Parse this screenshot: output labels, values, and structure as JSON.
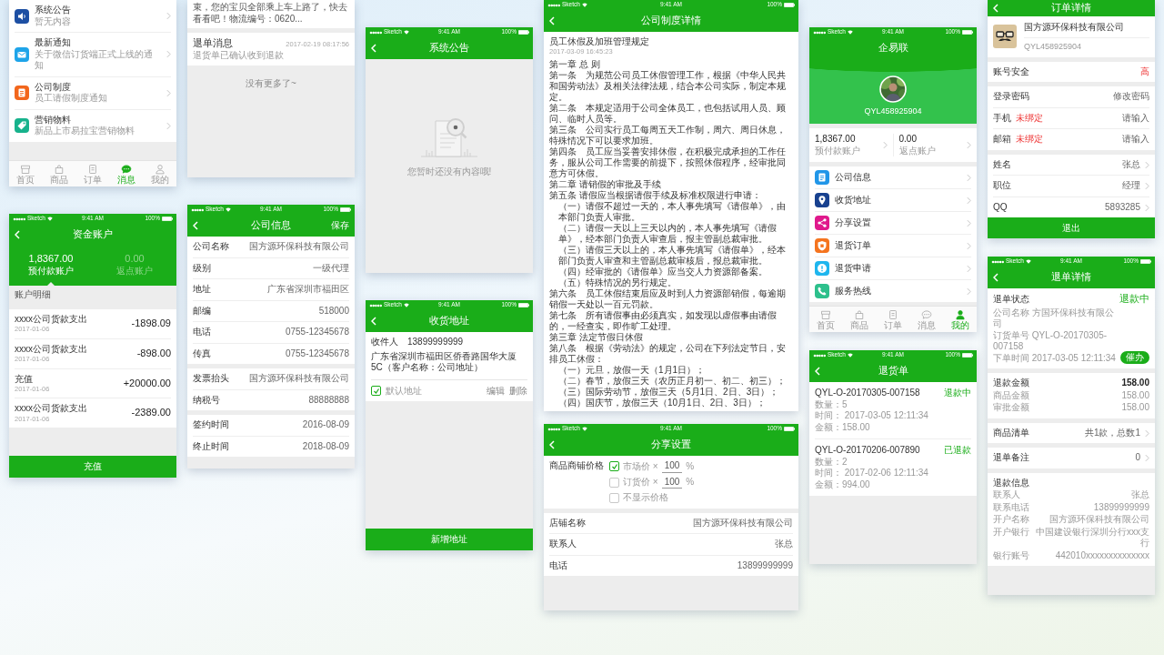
{
  "columns": [
    [
      {
        "blocks": [
          {
            "kind": "messages",
            "items": [
              {
                "title": "系统公告",
                "subtitle": "暂无内容",
                "color": "#1d4fa3"
              },
              {
                "title": "最新通知",
                "subtitle": "关于微信订货端正式上线的通知",
                "color": "#1ea4e9"
              },
              {
                "title": "公司制度",
                "subtitle": "员工请假制度通知",
                "color": "#f2661c"
              },
              {
                "title": "营销物料",
                "subtitle": "新品上市易拉宝营销物料",
                "color": "#17b28c"
              }
            ]
          }
        ],
        "tabs": [
          {
            "label": "首页",
            "selected": false
          },
          {
            "label": "商品",
            "selected": false
          },
          {
            "label": "订单",
            "selected": false
          },
          {
            "label": "消息",
            "selected": true
          },
          {
            "label": "我的",
            "selected": false
          }
        ]
      },
      {
        "status_bar": {
          "carrier": "Sketch",
          "time": "9:41 AM",
          "battery": "100%"
        },
        "nav": {
          "title": "资金账户",
          "back": true
        },
        "blocks": [
          {
            "kind": "accounts",
            "accounts": [
              {
                "amount": "1,8367.00",
                "label": "预付款账户",
                "selected": true
              },
              {
                "amount": "0.00",
                "label": "返点账户",
                "selected": false
              }
            ]
          },
          {
            "kind": "section_title",
            "text": "账户明细"
          },
          {
            "kind": "transactions",
            "items": [
              {
                "title": "xxxx公司货款支出",
                "date": "2017-01-06",
                "amount": "-1898.09"
              },
              {
                "title": "xxxx公司货款支出",
                "date": "2017-01-06",
                "amount": "-898.00"
              },
              {
                "title": "充值",
                "date": "2017-01-06",
                "amount": "+20000.00"
              },
              {
                "title": "xxxx公司货款支出",
                "date": "2017-01-06",
                "amount": "-2389.00"
              }
            ]
          }
        ],
        "button": "充值"
      }
    ],
    [
      {
        "blocks": [
          {
            "kind": "notice",
            "text": "束，您的宝贝全部乘上车上路了，快去看看吧！物流编号：0620..."
          },
          {
            "kind": "message",
            "title": "退单消息",
            "time": "2017-02-19 08:17:56",
            "body": "退货单已确认收到退款"
          },
          {
            "kind": "end_note",
            "text": "没有更多了~"
          }
        ]
      },
      {
        "status_bar": {
          "carrier": "Sketch",
          "time": "9:41 AM",
          "battery": "100%"
        },
        "nav": {
          "title": "公司信息",
          "back": true,
          "action": "保存"
        },
        "blocks": [
          {
            "kind": "rows",
            "rows": [
              {
                "label": "公司名称",
                "value": "国方源环保科技有限公司"
              },
              {
                "label": "级别",
                "value": "一级代理"
              },
              {
                "label": "地址",
                "value": "广东省深圳市福田区"
              },
              {
                "label": "邮编",
                "value": "518000"
              },
              {
                "label": "电话",
                "value": "0755-12345678"
              },
              {
                "label": "传真",
                "value": "0755-12345678"
              }
            ]
          },
          {
            "kind": "rows",
            "rows": [
              {
                "label": "发票抬头",
                "value": "国方源环保科技有限公司"
              },
              {
                "label": "纳税号",
                "value": "88888888"
              }
            ]
          },
          {
            "kind": "rows",
            "rows": [
              {
                "label": "签约时间",
                "value": "2016-08-09"
              },
              {
                "label": "终止时间",
                "value": "2018-08-09"
              }
            ]
          }
        ]
      }
    ],
    [
      {
        "status_bar": {
          "carrier": "Sketch",
          "time": "9:41 AM",
          "battery": "100%"
        },
        "nav": {
          "title": "系统公告",
          "back": true
        },
        "blocks": [
          {
            "kind": "empty",
            "text": "您暂时还没有内容哦!"
          }
        ]
      },
      {
        "status_bar": {
          "carrier": "Sketch",
          "time": "9:41 AM",
          "battery": "100%"
        },
        "nav": {
          "title": "收货地址",
          "back": true
        },
        "blocks": [
          {
            "kind": "address",
            "recipient": "收件人",
            "phone": "13899999999",
            "address": "广东省深圳市福田区侨香路国华大厦5C（客户名称：公司地址）",
            "default_label": "默认地址",
            "default": true,
            "actions": [
              "编辑",
              "删除"
            ]
          }
        ],
        "button": "新增地址"
      }
    ],
    [
      {
        "status_bar": {
          "carrier": "Sketch",
          "time": "9:41 AM",
          "battery": "100%"
        },
        "nav": {
          "title": "公司制度详情",
          "back": true
        },
        "blocks": [
          {
            "kind": "document",
            "title": "员工休假及加班管理规定",
            "date": "2017-03-09  16:45:23",
            "paragraphs": [
              {
                "kind": "chapter",
                "text": "第一章 总 则"
              },
              {
                "kind": "article",
                "text": "第一条　为规范公司员工休假管理工作，根据《中华人民共和国劳动法》及相关法律法规，结合本公司实际，制定本规定。"
              },
              {
                "kind": "article",
                "text": "第二条　本规定适用于公司全体员工，也包括试用人员、顾问、临时人员等。"
              },
              {
                "kind": "article",
                "text": "第三条　公司实行员工每周五天工作制，周六、周日休息，特殊情况下可以要求加班。"
              },
              {
                "kind": "article",
                "text": "第四条　员工应当妥善安排休假，在积极完成承担的工作任务，服从公司工作需要的前提下，按照休假程序，经审批同意方可休假。"
              },
              {
                "kind": "article",
                "text": "第二章 请销假的审批及手续"
              },
              {
                "kind": "article",
                "text": "第五条 请假应当根据请假手续及标准权限进行申请："
              },
              {
                "kind": "item",
                "text": "（一）请假不超过一天的，本人事先填写《请假单》，由本部门负责人审批。"
              },
              {
                "kind": "item",
                "text": "（二）请假一天以上三天以内的，本人事先填写《请假单》，经本部门负责人审查后，报主管副总裁审批。"
              },
              {
                "kind": "item",
                "text": "（三）请假三天以上的，本人事先填写《请假单》，经本部门负责人审查和主管副总裁审核后，报总裁审批。"
              },
              {
                "kind": "item",
                "text": "（四）经审批的《请假单》应当交人力资源部备案。"
              },
              {
                "kind": "item",
                "text": "（五）特殊情况的另行规定。"
              },
              {
                "kind": "article",
                "text": "第六条　员工休假结束后应及时到人力资源部销假，每逾期销假一天处以一百元罚款。"
              },
              {
                "kind": "article",
                "text": "第七条　所有请假事由必须真实，如发现以虚假事由请假的，一经查实，即作旷工处理。"
              },
              {
                "kind": "article",
                "text": "第三章 法定节假日休假"
              },
              {
                "kind": "article",
                "text": "第八条　根据《劳动法》的规定，公司在下列法定节日，安排员工休假："
              },
              {
                "kind": "item",
                "text": "（一）元旦，放假一天（1月1日）；"
              },
              {
                "kind": "item",
                "text": "（二）春节，放假三天（农历正月初一、初二、初三）；"
              },
              {
                "kind": "item",
                "text": "（三）国际劳动节，放假三天（5月1日、2日、3日）；"
              },
              {
                "kind": "item",
                "text": "（四）国庆节，放假三天（10月1日、2日、3日）；"
              }
            ]
          }
        ]
      },
      {
        "status_bar": {
          "carrier": "Sketch",
          "time": "9:41 AM",
          "battery": "100%"
        },
        "nav": {
          "title": "分享设置",
          "back": true
        },
        "blocks": [
          {
            "kind": "price_options",
            "label": "商品商铺价格",
            "options": [
              {
                "label": "市场价 ×",
                "value": "100",
                "unit": "%",
                "checked": true
              },
              {
                "label": "订货价 ×",
                "value": "100",
                "unit": "%",
                "checked": false
              },
              {
                "label": "不显示价格",
                "checked": false
              }
            ]
          },
          {
            "kind": "rows",
            "rows": [
              {
                "label": "店铺名称",
                "value": "国方源环保科技有限公司"
              },
              {
                "label": "联系人",
                "value": "张总"
              },
              {
                "label": "电话",
                "value": "13899999999"
              }
            ]
          }
        ]
      }
    ],
    [
      {
        "status_bar": {
          "carrier": "Sketch",
          "time": "9:41 AM",
          "battery": "100%"
        },
        "nav": {
          "title": "企易联",
          "back": false
        },
        "blocks": [
          {
            "kind": "profile",
            "user_id": "QYL458925904"
          },
          {
            "kind": "balances",
            "items": [
              {
                "amount": "1,8367.00",
                "label": "预付款账户"
              },
              {
                "amount": "0.00",
                "label": "返点账户"
              }
            ]
          },
          {
            "kind": "menu",
            "items": [
              {
                "label": "公司信息",
                "color": "#2196e8"
              },
              {
                "label": "收货地址",
                "color": "#18418f"
              },
              {
                "label": "分享设置",
                "color": "#e0198c"
              },
              {
                "label": "退货订单",
                "color": "#f5741f"
              },
              {
                "label": "退货申请",
                "color": "#1fb6ee"
              },
              {
                "label": "服务热线",
                "color": "#2dc08c"
              }
            ]
          }
        ],
        "tabs": [
          {
            "label": "首页",
            "selected": false
          },
          {
            "label": "商品",
            "selected": false
          },
          {
            "label": "订单",
            "selected": false
          },
          {
            "label": "消息",
            "selected": false
          },
          {
            "label": "我的",
            "selected": true
          }
        ]
      },
      {
        "status_bar": {
          "carrier": "Sketch",
          "time": "9:41 AM",
          "battery": "100%"
        },
        "nav": {
          "title": "退货单",
          "back": true
        },
        "blocks": [
          {
            "kind": "orders",
            "orders": [
              {
                "number": "QYL-O-20170305-007158",
                "status": "退款中",
                "lines": [
                  "数量：5",
                  "时间： 2017-03-05  12:11:34",
                  "金额：158.00"
                ]
              },
              {
                "number": "QYL-O-20170206-007890",
                "status": "已退款",
                "lines": [
                  "数量：2",
                  "时间： 2017-02-06  12:11:34",
                  "金额：994.00"
                ]
              }
            ]
          }
        ]
      }
    ],
    [
      {
        "nav": {
          "title": "订单详情",
          "back": true
        },
        "blocks": [
          {
            "kind": "company",
            "name": "国方源环保科技有限公司",
            "id": "QYL458925904"
          },
          {
            "kind": "rows",
            "rows": [
              {
                "label": "账号安全",
                "value": "高",
                "alert": true
              }
            ]
          },
          {
            "kind": "rows",
            "rows": [
              {
                "label": "登录密码",
                "value": "修改密码"
              },
              {
                "label": "手机",
                "tag": "未绑定",
                "value": "请输入"
              },
              {
                "label": "邮箱",
                "tag": "未绑定",
                "value": "请输入"
              }
            ]
          },
          {
            "kind": "rows",
            "rows": [
              {
                "label": "姓名",
                "value": "张总",
                "chevron": true
              },
              {
                "label": "职位",
                "value": "经理",
                "chevron": true
              },
              {
                "label": "QQ",
                "value": "5893285",
                "chevron": true
              }
            ]
          }
        ],
        "button": "退出"
      },
      {
        "status_bar": {
          "carrier": "Sketch",
          "time": "9:41 AM",
          "battery": "100%"
        },
        "nav": {
          "title": "退单详情",
          "back": true
        },
        "blocks": [
          {
            "kind": "status",
            "label": "退单状态",
            "status": "退款中",
            "lines": [
              "公司名称 方国环保科技有限公司",
              "订货单号 QYL-O-20170305-007158",
              "下单时间 2017-03-05  12:11:34"
            ],
            "action": "催办"
          },
          {
            "kind": "details",
            "title": "退款金额",
            "value": "158.00",
            "rows": [
              {
                "label": "商品金额",
                "value": "158.00"
              },
              {
                "label": "审批金额",
                "value": "158.00"
              }
            ]
          },
          {
            "kind": "rows",
            "rows": [
              {
                "label": "商品清单",
                "value": "共1款，总数1",
                "chevron": true
              }
            ]
          },
          {
            "kind": "rows",
            "rows": [
              {
                "label": "退单备注",
                "value": "0",
                "chevron": true
              }
            ]
          },
          {
            "kind": "details",
            "title": "退款信息",
            "rows": [
              {
                "label": "联系人",
                "value": "张总"
              },
              {
                "label": "联系电话",
                "value": "13899999999"
              },
              {
                "label": "开户名称",
                "value": "国方源环保科技有限公司"
              },
              {
                "label": "开户银行",
                "value": "中国建设银行深圳分行xxx支行"
              },
              {
                "label": "银行账号",
                "value": "442010xxxxxxxxxxxxxx"
              }
            ]
          }
        ]
      }
    ]
  ]
}
